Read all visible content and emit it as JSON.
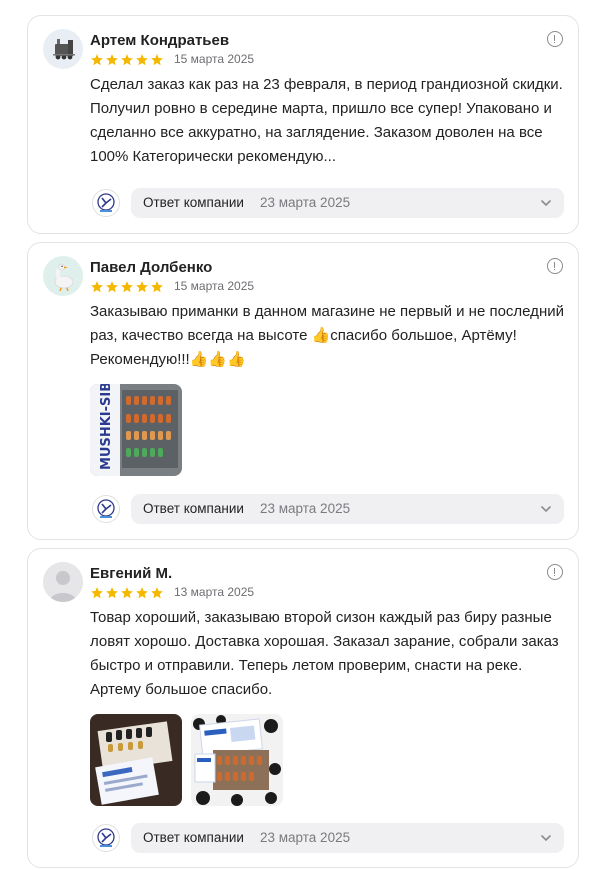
{
  "reviews": [
    {
      "author": "Артем Кондратьев",
      "date": "15 марта 2025",
      "rating": 5,
      "text": "Сделал заказ как раз на 23 февраля, в период грандиозной скидки. Получил ровно в середине марта, пришло все супер! Упаковано и сделанно все аккуратно, на заглядение. Заказом доволен на все 100% Категорически рекомендую...",
      "avatar_icon": "train-icon",
      "reply": {
        "label": "Ответ компании",
        "date": "23 марта 2025"
      }
    },
    {
      "author": "Павел Долбенко",
      "date": "15 марта 2025",
      "rating": 5,
      "text": "Заказываю приманки в данном магазине не первый и не последний раз, качество всегда на высоте 👍спасибо большое, Артёму! Рекомендую!!!👍👍👍",
      "avatar_icon": "goose-icon",
      "photo_text": "MUSHKI-SIB",
      "reply": {
        "label": "Ответ компании",
        "date": "23 марта 2025"
      }
    },
    {
      "author": "Евгений М.",
      "date": "13 марта 2025",
      "rating": 5,
      "text": "Товар хороший, заказываю второй сизон каждый раз биру разные ловят хорошо. Доставка хорошая. Заказал зарание, собрали заказ быстро и отправили. Теперь летом проверим, снасти на реке. Артему большое спасибо.",
      "avatar_icon": "default-user-icon",
      "reply": {
        "label": "Ответ компании",
        "date": "23 марта 2025"
      }
    }
  ],
  "colors": {
    "star": "#f5b800",
    "border": "#e3e3e6",
    "reply_bg": "#f0f0f2"
  }
}
